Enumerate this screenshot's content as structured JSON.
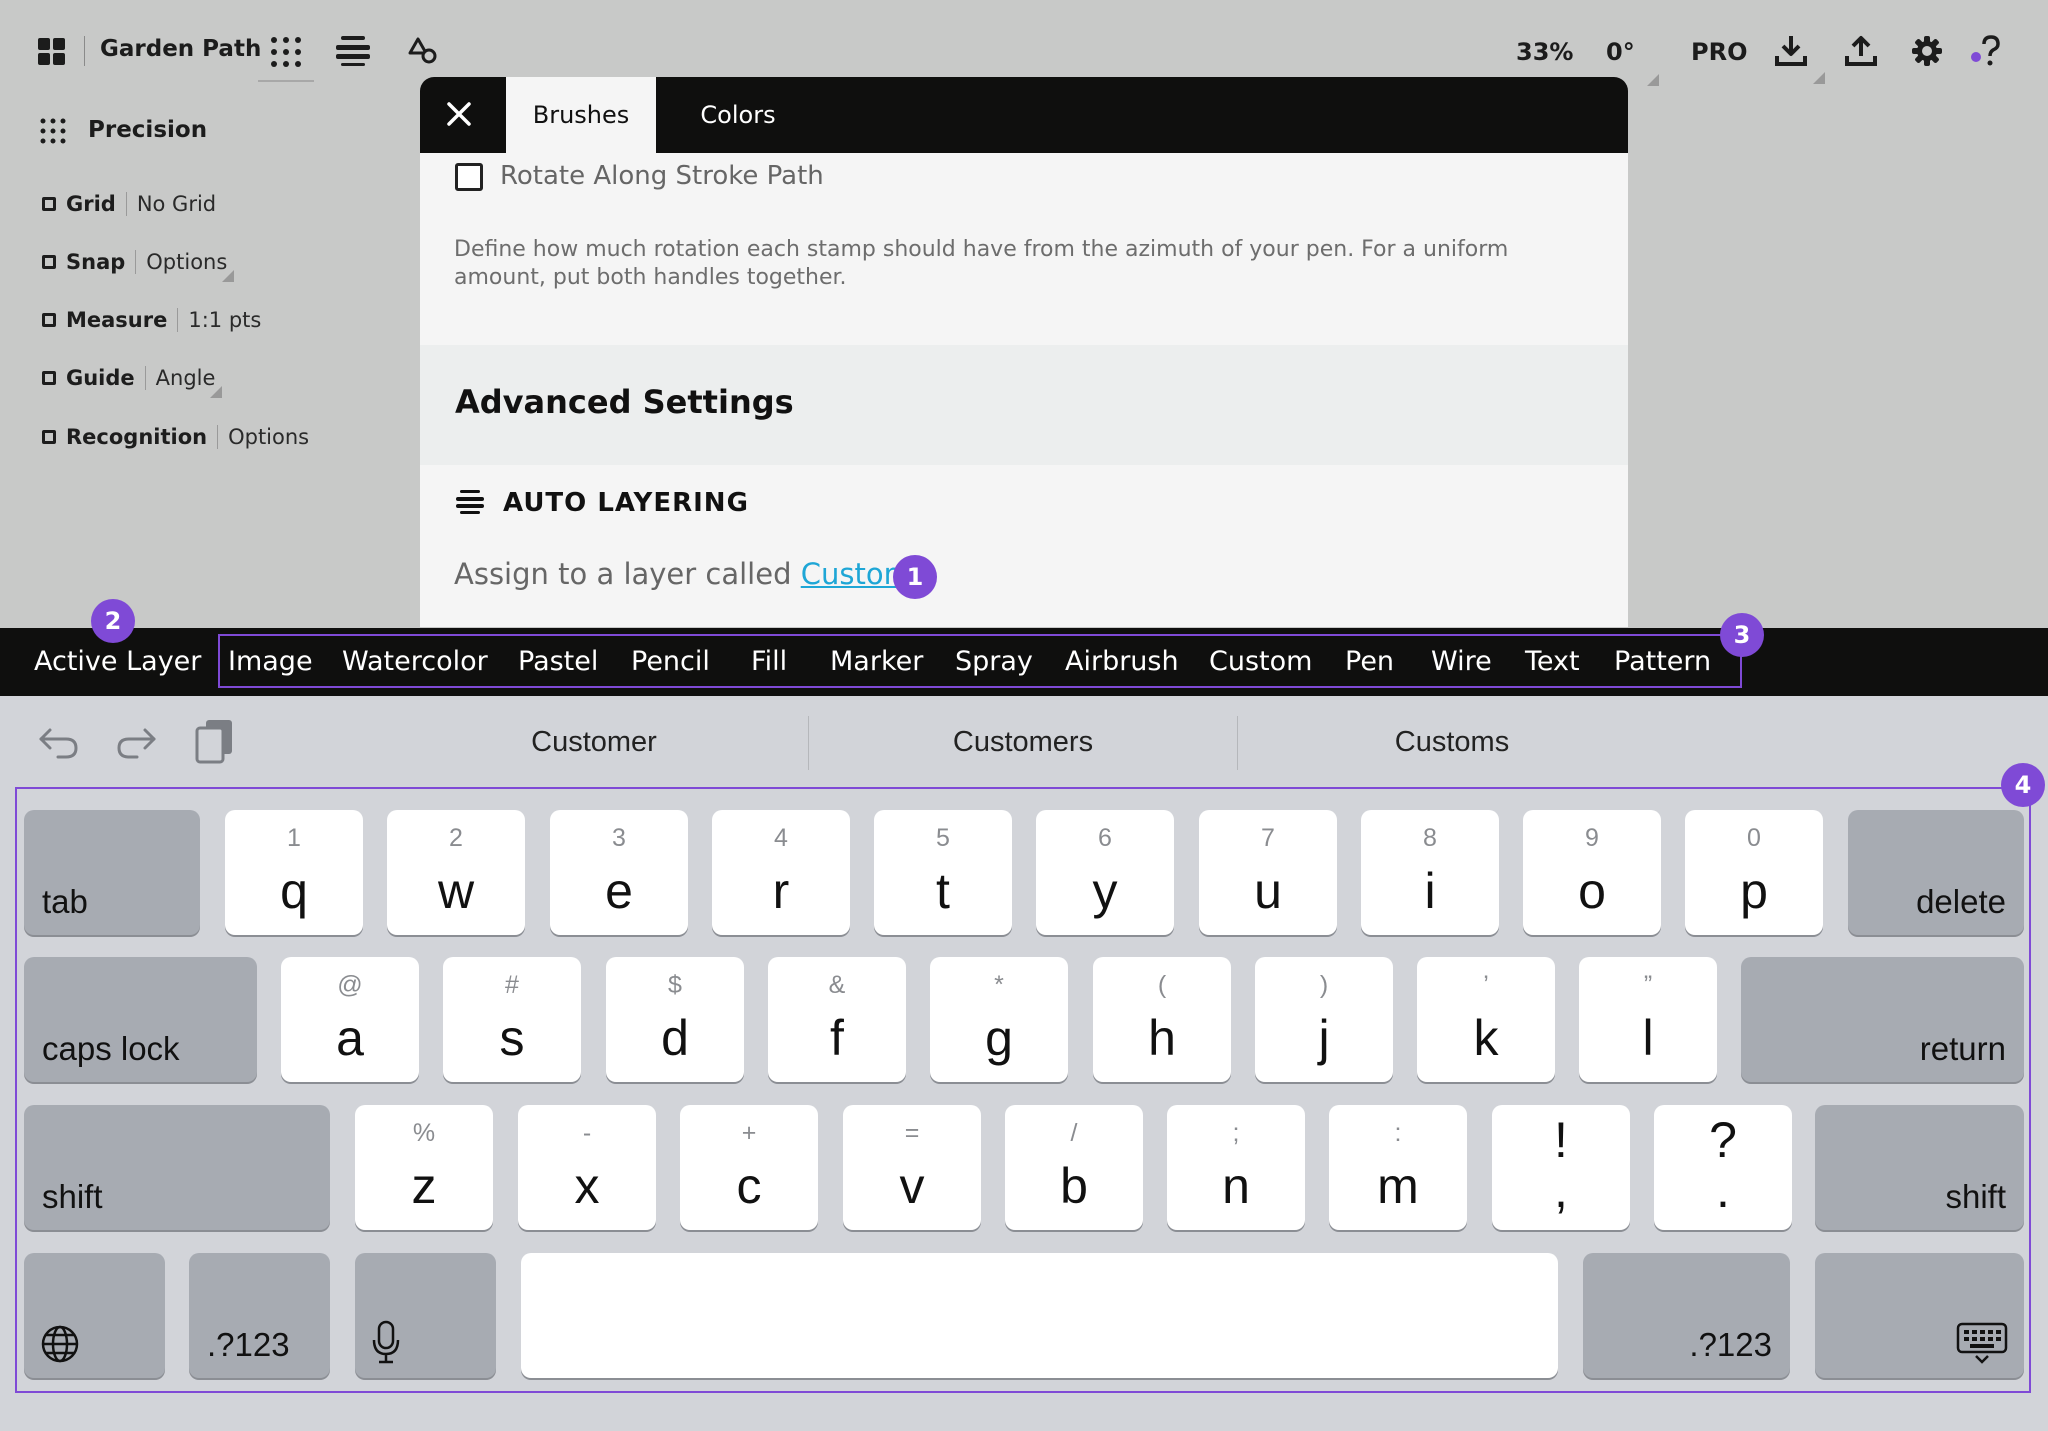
{
  "app": {
    "title": "Garden Path",
    "zoom": "33%",
    "rotation": "0°",
    "pro_label": "PRO",
    "accent": "#7f4ad6",
    "link_color": "#1ea6d6"
  },
  "toolbar": {
    "icons": [
      "grid-view-icon",
      "apps-icon",
      "layers-icon",
      "shapes-icon",
      "download-icon",
      "upload-icon",
      "gear-icon",
      "help-icon"
    ]
  },
  "precision": {
    "title": "Precision",
    "items": [
      {
        "name": "Grid",
        "value": "No Grid"
      },
      {
        "name": "Snap",
        "value": "Options"
      },
      {
        "name": "Measure",
        "value": "1:1 pts"
      },
      {
        "name": "Guide",
        "value": "Angle"
      },
      {
        "name": "Recognition",
        "value": "Options"
      }
    ]
  },
  "panel": {
    "tabs": [
      "Brushes",
      "Colors"
    ],
    "active_tab": "Brushes",
    "rotate_label": "Rotate Along Stroke Path",
    "description": "Define how much rotation each stamp should have from the azimuth of your pen. For a uniform amount, put both handles together.",
    "advanced_title": "Advanced Settings",
    "auto_layering_title": "AUTO LAYERING",
    "assign_text": "Assign to a layer called",
    "assign_link": "Custom"
  },
  "layer_bar": {
    "active_label": "Active Layer",
    "items": [
      "Image",
      "Watercolor",
      "Pastel",
      "Pencil",
      "Fill",
      "Marker",
      "Spray",
      "Airbrush",
      "Custom",
      "Pen",
      "Wire",
      "Text",
      "Pattern"
    ]
  },
  "badges": [
    "1",
    "2",
    "3",
    "4"
  ],
  "keyboard": {
    "suggestions": [
      "Customer",
      "Customers",
      "Customs"
    ],
    "row1": [
      {
        "main": "q",
        "sub": "1"
      },
      {
        "main": "w",
        "sub": "2"
      },
      {
        "main": "e",
        "sub": "3"
      },
      {
        "main": "r",
        "sub": "4"
      },
      {
        "main": "t",
        "sub": "5"
      },
      {
        "main": "y",
        "sub": "6"
      },
      {
        "main": "u",
        "sub": "7"
      },
      {
        "main": "i",
        "sub": "8"
      },
      {
        "main": "o",
        "sub": "9"
      },
      {
        "main": "p",
        "sub": "0"
      }
    ],
    "row2": [
      {
        "main": "a",
        "sub": "@"
      },
      {
        "main": "s",
        "sub": "#"
      },
      {
        "main": "d",
        "sub": "$"
      },
      {
        "main": "f",
        "sub": "&"
      },
      {
        "main": "g",
        "sub": "*"
      },
      {
        "main": "h",
        "sub": "("
      },
      {
        "main": "j",
        "sub": ")"
      },
      {
        "main": "k",
        "sub": "’"
      },
      {
        "main": "l",
        "sub": "”"
      }
    ],
    "row3": [
      {
        "main": "z",
        "sub": "%"
      },
      {
        "main": "x",
        "sub": "-"
      },
      {
        "main": "c",
        "sub": "+"
      },
      {
        "main": "v",
        "sub": "="
      },
      {
        "main": "b",
        "sub": "/"
      },
      {
        "main": "n",
        "sub": ";"
      },
      {
        "main": "m",
        "sub": ":"
      },
      {
        "main": ",",
        "sub": "!"
      },
      {
        "main": ".",
        "sub": "?"
      }
    ],
    "tab": "tab",
    "delete": "delete",
    "caps_lock": "caps lock",
    "return": "return",
    "shift": "shift",
    "numbers": ".?123"
  }
}
